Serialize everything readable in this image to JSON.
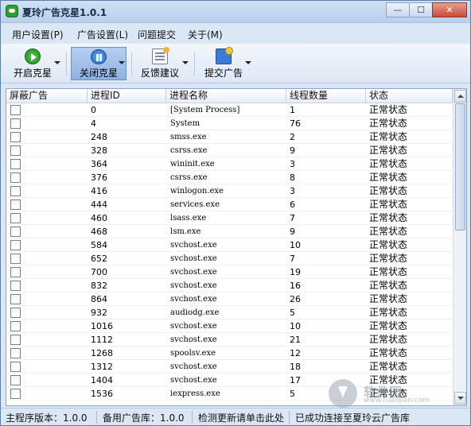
{
  "window": {
    "title": "夏玲广告克星1.0.1",
    "controls": [
      "—",
      "☐",
      "✕"
    ]
  },
  "menu": {
    "items": [
      "用户设置(P)",
      "广告设置(L)",
      "问题提交",
      "关于(M)"
    ]
  },
  "toolbar": {
    "start_label": "开启克星",
    "stop_label": "关闭克星",
    "feedback_label": "反馈建议",
    "submit_label": "提交广告"
  },
  "table": {
    "headers": [
      "屏蔽广告",
      "进程ID",
      "进程名称",
      "线程数量",
      "状态"
    ],
    "rows": [
      {
        "pid": "0",
        "name": "[System Process]",
        "threads": "1",
        "status": "正常状态"
      },
      {
        "pid": "4",
        "name": "System",
        "threads": "76",
        "status": "正常状态"
      },
      {
        "pid": "248",
        "name": "smss.exe",
        "threads": "2",
        "status": "正常状态"
      },
      {
        "pid": "328",
        "name": "csrss.exe",
        "threads": "9",
        "status": "正常状态"
      },
      {
        "pid": "364",
        "name": "wininit.exe",
        "threads": "3",
        "status": "正常状态"
      },
      {
        "pid": "376",
        "name": "csrss.exe",
        "threads": "8",
        "status": "正常状态"
      },
      {
        "pid": "416",
        "name": "winlogon.exe",
        "threads": "3",
        "status": "正常状态"
      },
      {
        "pid": "444",
        "name": "services.exe",
        "threads": "6",
        "status": "正常状态"
      },
      {
        "pid": "460",
        "name": "lsass.exe",
        "threads": "7",
        "status": "正常状态"
      },
      {
        "pid": "468",
        "name": "lsm.exe",
        "threads": "9",
        "status": "正常状态"
      },
      {
        "pid": "584",
        "name": "svchost.exe",
        "threads": "10",
        "status": "正常状态"
      },
      {
        "pid": "652",
        "name": "svchost.exe",
        "threads": "7",
        "status": "正常状态"
      },
      {
        "pid": "700",
        "name": "svchost.exe",
        "threads": "19",
        "status": "正常状态"
      },
      {
        "pid": "832",
        "name": "svchost.exe",
        "threads": "16",
        "status": "正常状态"
      },
      {
        "pid": "864",
        "name": "svchost.exe",
        "threads": "26",
        "status": "正常状态"
      },
      {
        "pid": "932",
        "name": "audiodg.exe",
        "threads": "5",
        "status": "正常状态"
      },
      {
        "pid": "1016",
        "name": "svchost.exe",
        "threads": "10",
        "status": "正常状态"
      },
      {
        "pid": "1112",
        "name": "svchost.exe",
        "threads": "21",
        "status": "正常状态"
      },
      {
        "pid": "1268",
        "name": "spoolsv.exe",
        "threads": "12",
        "status": "正常状态"
      },
      {
        "pid": "1312",
        "name": "svchost.exe",
        "threads": "18",
        "status": "正常状态"
      },
      {
        "pid": "1404",
        "name": "svchost.exe",
        "threads": "17",
        "status": "正常状态"
      },
      {
        "pid": "1536",
        "name": "iexpress.exe",
        "threads": "5",
        "status": "正常状态"
      }
    ]
  },
  "watermark": {
    "text": "软件园",
    "sub": "www.ruanjian.com"
  },
  "status": {
    "main_version": "主程序版本：1.0.0",
    "ad_library": "备用广告库：1.0.0",
    "update_link": "检测更新请单击此处",
    "connection": "已成功连接至夏玲云广告库"
  }
}
